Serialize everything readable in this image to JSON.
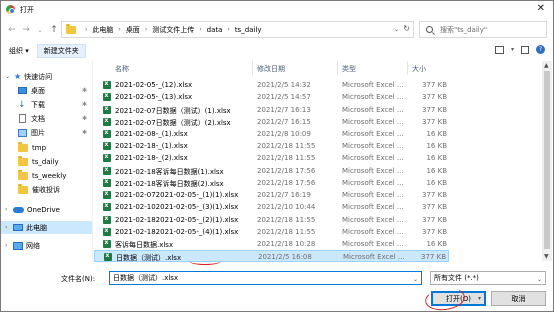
{
  "window": {
    "title": "打开"
  },
  "address": {
    "crumbs": [
      "此电脑",
      "桌面",
      "测试文件上传",
      "data",
      "ts_daily"
    ]
  },
  "search": {
    "placeholder": "搜索\"ts_daily\""
  },
  "toolbar": {
    "organize": "组织 ▾",
    "new_folder": "新建文件夹"
  },
  "nav": {
    "items": [
      {
        "label": "快速访问",
        "icon": "star-icon"
      },
      {
        "label": "桌面",
        "icon": "desktop-icon",
        "pinned": true
      },
      {
        "label": "下载",
        "icon": "download-icon",
        "pinned": true
      },
      {
        "label": "文档",
        "icon": "document-icon",
        "pinned": true
      },
      {
        "label": "图片",
        "icon": "picture-icon",
        "pinned": true
      },
      {
        "label": "tmp",
        "icon": "folder-icon"
      },
      {
        "label": "ts_daily",
        "icon": "folder-icon"
      },
      {
        "label": "ts_weekly",
        "icon": "folder-icon"
      },
      {
        "label": "催收投诉",
        "icon": "folder-icon"
      },
      {
        "label": "OneDrive",
        "icon": "cloud-icon"
      },
      {
        "label": "此电脑",
        "icon": "computer-icon",
        "selected": true
      },
      {
        "label": "网络",
        "icon": "network-icon"
      }
    ]
  },
  "columns": {
    "name": "名称",
    "date": "修改日期",
    "type": "类型",
    "size": "大小"
  },
  "files": [
    {
      "name": "2021-02-05-_(12).xlsx",
      "date": "2021/2/5 14:32",
      "type": "Microsoft Excel ...",
      "size": "377 KB"
    },
    {
      "name": "2021-02-05-_(13).xlsx",
      "date": "2021/2/5 14:57",
      "type": "Microsoft Excel ...",
      "size": "377 KB"
    },
    {
      "name": "2021-02-07日数据（测试）(1).xlsx",
      "date": "2021/2/7 16:13",
      "type": "Microsoft Excel ...",
      "size": "377 KB"
    },
    {
      "name": "2021-02-07日数据（测试）(2).xlsx",
      "date": "2021/2/7 16:15",
      "type": "Microsoft Excel ...",
      "size": "377 KB"
    },
    {
      "name": "2021-02-08-_(1).xlsx",
      "date": "2021/2/8 10:09",
      "type": "Microsoft Excel ...",
      "size": "16 KB"
    },
    {
      "name": "2021-02-18-_(1).xlsx",
      "date": "2021/2/18 11:55",
      "type": "Microsoft Excel ...",
      "size": "16 KB"
    },
    {
      "name": "2021-02-18-_(2).xlsx",
      "date": "2021/2/18 11:55",
      "type": "Microsoft Excel ...",
      "size": "16 KB"
    },
    {
      "name": "2021-02-18客诉每日数据(1).xlsx",
      "date": "2021/2/18 17:56",
      "type": "Microsoft Excel ...",
      "size": "16 KB"
    },
    {
      "name": "2021-02-18客诉每日数据(2).xlsx",
      "date": "2021/2/18 17:56",
      "type": "Microsoft Excel ...",
      "size": "16 KB"
    },
    {
      "name": "2021-02-072021-02-05-_(1)(1).xlsx",
      "date": "2021/2/7 16:19",
      "type": "Microsoft Excel ...",
      "size": "377 KB"
    },
    {
      "name": "2021-02-102021-02-05-_(3)(1).xlsx",
      "date": "2021/2/10 10:44",
      "type": "Microsoft Excel ...",
      "size": "377 KB"
    },
    {
      "name": "2021-02-182021-02-05-_(2)(1).xlsx",
      "date": "2021/2/18 11:55",
      "type": "Microsoft Excel ...",
      "size": "377 KB"
    },
    {
      "name": "2021-02-182021-02-05-_(4)(1).xlsx",
      "date": "2021/2/18 11:55",
      "type": "Microsoft Excel ...",
      "size": "377 KB"
    },
    {
      "name": "客诉每日数据.xlsx",
      "date": "2021/2/18 10:28",
      "type": "Microsoft Excel ...",
      "size": "16 KB"
    },
    {
      "name": "日数据（测试）.xlsx",
      "date": "2021/2/5 16:08",
      "type": "Microsoft Excel ...",
      "size": "377 KB",
      "selected": true
    }
  ],
  "filename": {
    "label": "文件名(N):",
    "value": "日数据（测试）.xlsx"
  },
  "filetype": {
    "value": "所有文件 (*.*)"
  },
  "buttons": {
    "open": "打开(O)",
    "cancel": "取消"
  },
  "colors": {
    "selection": "#cce8ff",
    "accent": "#0078d7",
    "annotation": "#d32020",
    "excel_icon": "#1f7a44"
  }
}
